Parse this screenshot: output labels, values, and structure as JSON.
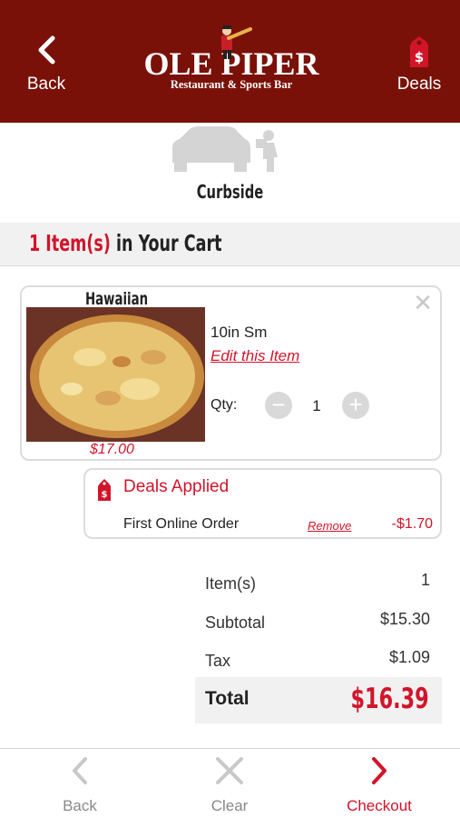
{
  "header": {
    "back_label": "Back",
    "back_icon": "chevron-left-icon",
    "logo_title": "OLE PIPER",
    "logo_subtitle": "Restaurant & Sports Bar",
    "deals_label": "Deals",
    "deals_icon": "price-tag-dollar-icon"
  },
  "order_type": {
    "icon": "car-curbside-icon",
    "label": "Curbside"
  },
  "cart": {
    "title_count": "1 Item(s)",
    "title_rest": "in Your Cart"
  },
  "items": [
    {
      "name": "Hawaiian",
      "price": "$17.00",
      "size": "10in Sm",
      "edit_label": "Edit this Item",
      "qty_label": "Qty:",
      "qty": "1",
      "close_icon": "close-icon"
    }
  ],
  "deals": {
    "title": "Deals Applied",
    "items": [
      {
        "name": "First Online Order",
        "remove_label": "Remove",
        "amount": "-$1.70"
      }
    ]
  },
  "summary": {
    "items_label": "Item(s)",
    "items_value": "1",
    "subtotal_label": "Subtotal",
    "subtotal_value": "$15.30",
    "tax_label": "Tax",
    "tax_value": "$1.09",
    "total_label": "Total",
    "total_value": "$16.39"
  },
  "bottom_nav": {
    "back_label": "Back",
    "clear_label": "Clear",
    "checkout_label": "Checkout"
  },
  "colors": {
    "brand_maroon": "#7a1108",
    "accent_red": "#d2142a",
    "muted_gray": "#888888"
  }
}
